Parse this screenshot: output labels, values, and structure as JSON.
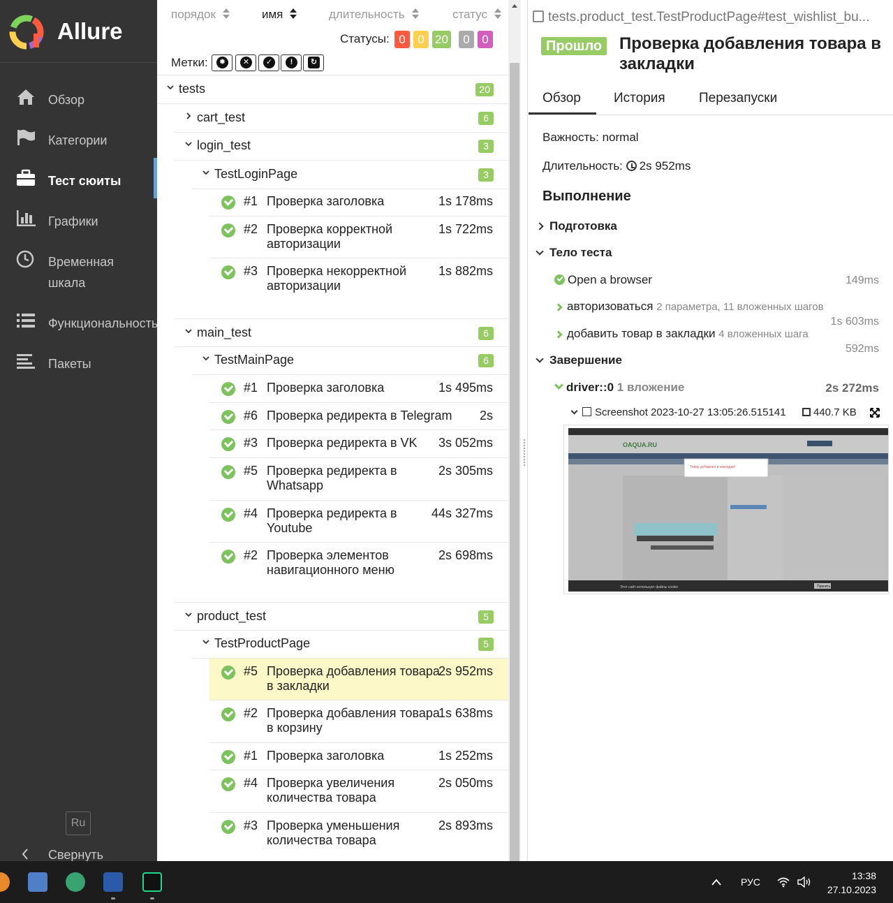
{
  "sidebar": {
    "app_name": "Allure",
    "nav": [
      {
        "label": "Обзор",
        "icon": "home-icon"
      },
      {
        "label": "Категории",
        "icon": "flag-icon"
      },
      {
        "label": "Тест сюиты",
        "icon": "briefcase-icon"
      },
      {
        "label": "Графики",
        "icon": "bar-chart-icon"
      },
      {
        "label": "Временная\nшкала",
        "icon": "clock-icon"
      },
      {
        "label": "Функциональность",
        "icon": "list-icon"
      },
      {
        "label": "Пакеты",
        "icon": "align-left-icon"
      }
    ],
    "active_index": 2,
    "language": "Ru",
    "collapse_label": "Свернуть"
  },
  "tree": {
    "sort": {
      "order": "порядок",
      "name": "имя",
      "duration": "длительность",
      "status": "статус"
    },
    "statuses_label": "Статусы:",
    "status_counts": [
      {
        "value": "0",
        "color": "#fd5a3e"
      },
      {
        "value": "0",
        "color": "#ffd050"
      },
      {
        "value": "20",
        "color": "#97cc64"
      },
      {
        "value": "0",
        "color": "#aaaaaa"
      },
      {
        "value": "0",
        "color": "#d35ebe"
      }
    ],
    "marks_label": "Метки:",
    "root": {
      "name": "tests",
      "count": "20"
    },
    "cart_test": {
      "name": "cart_test",
      "count": "6"
    },
    "login_test": {
      "name": "login_test",
      "count": "3",
      "suite": {
        "name": "TestLoginPage",
        "count": "3"
      },
      "tests": [
        {
          "num": "#1",
          "name": "Проверка заголовка",
          "duration": "1s 178ms"
        },
        {
          "num": "#2",
          "name": "Проверка корректной авторизации",
          "duration": "1s 722ms"
        },
        {
          "num": "#3",
          "name": "Проверка некорректной авторизации",
          "duration": "1s 882ms"
        }
      ]
    },
    "main_test": {
      "name": "main_test",
      "count": "6",
      "suite": {
        "name": "TestMainPage",
        "count": "6"
      },
      "tests": [
        {
          "num": "#1",
          "name": "Проверка заголовка",
          "duration": "1s 495ms"
        },
        {
          "num": "#6",
          "name": "Проверка редиректа в Telegram",
          "duration": "2s"
        },
        {
          "num": "#3",
          "name": "Проверка редиректа в VK",
          "duration": "3s 052ms"
        },
        {
          "num": "#5",
          "name": "Проверка редиректа в Whatsapp",
          "duration": "2s 305ms"
        },
        {
          "num": "#4",
          "name": "Проверка редиректа в Youtube",
          "duration": "44s 327ms"
        },
        {
          "num": "#2",
          "name": "Проверка элементов навигационного меню",
          "duration": "2s 698ms"
        }
      ]
    },
    "product_test": {
      "name": "product_test",
      "count": "5",
      "suite": {
        "name": "TestProductPage",
        "count": "5"
      },
      "tests": [
        {
          "num": "#5",
          "name": "Проверка добавления товара в закладки",
          "duration": "2s 952ms"
        },
        {
          "num": "#2",
          "name": "Проверка добавления товара в корзину",
          "duration": "1s 638ms"
        },
        {
          "num": "#1",
          "name": "Проверка заголовка",
          "duration": "1s 252ms"
        },
        {
          "num": "#4",
          "name": "Проверка увеличения количества товара",
          "duration": "2s 050ms"
        },
        {
          "num": "#3",
          "name": "Проверка уменьшения количества товара",
          "duration": "2s 893ms"
        }
      ]
    }
  },
  "detail": {
    "breadcrumb": "tests.product_test.TestProductPage#test_wishlist_bu...",
    "status": "Прошло",
    "title": "Проверка добавления товара в закладки",
    "tabs": [
      "Обзор",
      "История",
      "Перезапуски"
    ],
    "severity": "Важность: normal",
    "duration_label": "Длительность:",
    "duration": "2s 952ms",
    "execution": "Выполнение",
    "setup": "Подготовка",
    "body": "Тело теста",
    "steps": [
      {
        "name": "Open a browser",
        "sub": "",
        "duration": "149ms"
      },
      {
        "name": "авторизоваться",
        "sub": "2 параметра, 11 вложенных шагов",
        "duration": "1s 603ms"
      },
      {
        "name": "добавить товар в закладки",
        "sub": "4 вложенных шага",
        "duration": "592ms"
      }
    ],
    "teardown": "Завершение",
    "driver": {
      "name": "driver::0",
      "sub": "1 вложение",
      "duration": "2s 272ms"
    },
    "attachment": {
      "name": "Screenshot 2023-10-27 13:05:26.515141",
      "size": "440.7 KB"
    },
    "screenshot": {
      "site_logo": "OAQUA.RU",
      "popup_text": "Товар добавлен в закладки!",
      "cookie_text": "Этот сайт использует файлы cookie",
      "cookie_btn": "Принять"
    }
  },
  "taskbar": {
    "lang": "РУС",
    "time": "13:38",
    "date": "27.10.2023"
  }
}
